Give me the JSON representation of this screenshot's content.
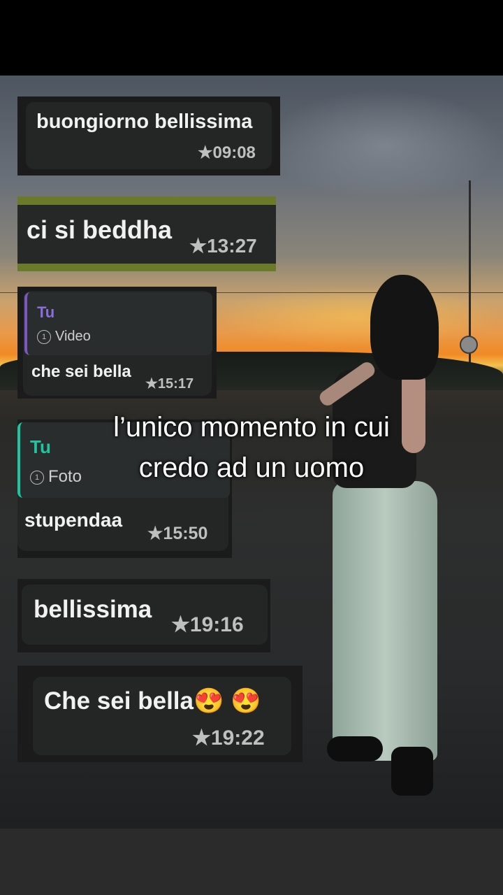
{
  "messages": [
    {
      "text": "buongiorno bellissima",
      "time": "★09:08"
    },
    {
      "text": "ci si beddha",
      "time": "★13:27"
    },
    {
      "reply_author": "Tu",
      "reply_media": "Video",
      "text": "che sei bella",
      "time": "★15:17"
    },
    {
      "reply_author": "Tu",
      "reply_media": "Foto",
      "text": "stupendaa",
      "time": "★15:50"
    },
    {
      "text": "bellissima",
      "time": "★19:16"
    },
    {
      "text": "Che sei bella😍 😍",
      "time": "★19:22"
    }
  ],
  "caption": {
    "line1": "l’unico momento in cui",
    "line2": "credo ad un uomo"
  },
  "icons": {
    "star": "star-icon",
    "view_once": "view-once-icon"
  },
  "view_once_glyph": "1",
  "colors": {
    "reply_accent_1": "#7e57c2",
    "reply_accent_2": "#1fc5a0",
    "bubble": "#242626",
    "highlight": "#6b7a2a"
  }
}
